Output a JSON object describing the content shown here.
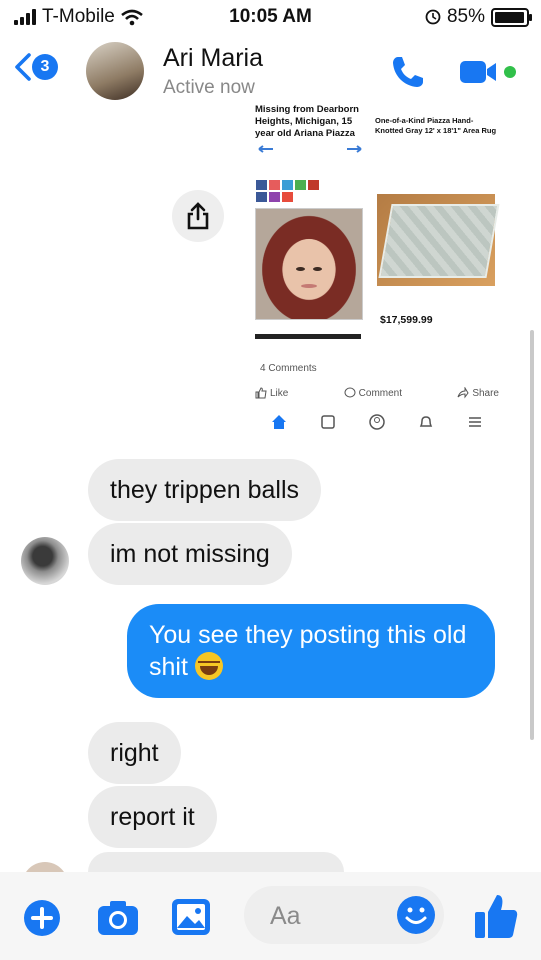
{
  "status": {
    "carrier": "T-Mobile",
    "time": "10:05 AM",
    "battery": "85%",
    "battery_level": 0.85
  },
  "header": {
    "back_badge": "3",
    "name": "Ari Maria",
    "status": "Active now"
  },
  "shared_post": {
    "left_title": "Missing from Dearborn Heights, Michigan, 15 year old Ariana Piazza",
    "right_title": "One-of-a-Kind Piazza Hand-Knotted Gray 12' x 18'1\" Area Rug",
    "price": "$17,599.99",
    "comments": "4 Comments",
    "actions": [
      "Like",
      "Comment",
      "Share"
    ]
  },
  "messages": [
    {
      "from": "them",
      "text": "they trippen balls"
    },
    {
      "from": "them",
      "text": "im not missing"
    },
    {
      "from": "me",
      "text": "You see they posting this old shit"
    },
    {
      "from": "them",
      "text": "right"
    },
    {
      "from": "them",
      "text": "report it"
    }
  ],
  "composer": {
    "placeholder": "Aa"
  },
  "colors": {
    "messenger_blue": "#1b8cf7",
    "incoming_bubble": "#ebebeb",
    "active_green": "#31c04a"
  },
  "icons": [
    "signal-bars-icon",
    "wifi-icon",
    "alarm-icon",
    "battery-icon",
    "back-chevron-icon",
    "phone-icon",
    "video-icon",
    "share-icon",
    "plus-icon",
    "camera-icon",
    "gallery-icon",
    "emoji-icon",
    "thumbs-up-icon"
  ]
}
